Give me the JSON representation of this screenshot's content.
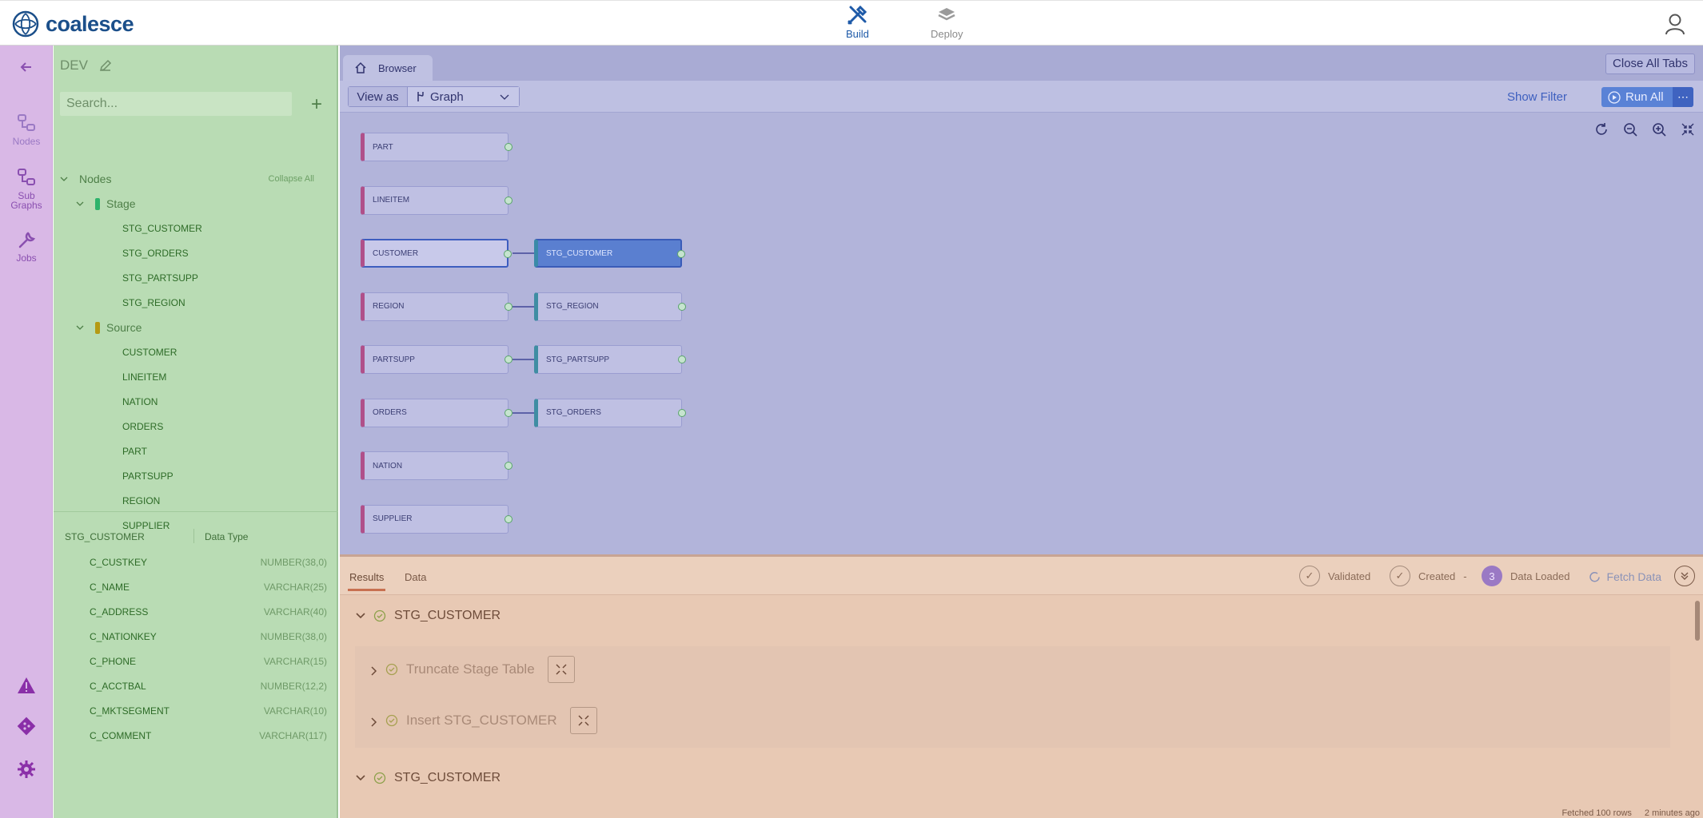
{
  "app": {
    "name": "coalesce"
  },
  "topnav": {
    "build": "Build",
    "deploy": "Deploy"
  },
  "rail": {
    "nodes": "Nodes",
    "subgraphs": "Sub Graphs",
    "jobs": "Jobs"
  },
  "sidebar": {
    "env": "DEV",
    "search_placeholder": "Search...",
    "collapse_all": "Collapse All",
    "root": "Nodes",
    "groups": [
      {
        "label": "Stage",
        "color": "#2db36b",
        "items": [
          "STG_CUSTOMER",
          "STG_ORDERS",
          "STG_PARTSUPP",
          "STG_REGION"
        ]
      },
      {
        "label": "Source",
        "color": "#b59a14",
        "items": [
          "CUSTOMER",
          "LINEITEM",
          "NATION",
          "ORDERS",
          "PART",
          "PARTSUPP",
          "REGION",
          "SUPPLIER"
        ]
      }
    ],
    "columns_header": {
      "name": "STG_CUSTOMER",
      "type": "Data Type"
    },
    "columns": [
      {
        "name": "C_CUSTKEY",
        "type": "NUMBER(38,0)"
      },
      {
        "name": "C_NAME",
        "type": "VARCHAR(25)"
      },
      {
        "name": "C_ADDRESS",
        "type": "VARCHAR(40)"
      },
      {
        "name": "C_NATIONKEY",
        "type": "NUMBER(38,0)"
      },
      {
        "name": "C_PHONE",
        "type": "VARCHAR(15)"
      },
      {
        "name": "C_ACCTBAL",
        "type": "NUMBER(12,2)"
      },
      {
        "name": "C_MKTSEGMENT",
        "type": "VARCHAR(10)"
      },
      {
        "name": "C_COMMENT",
        "type": "VARCHAR(117)"
      }
    ]
  },
  "browser": {
    "tab": "Browser",
    "close_all": "Close All Tabs",
    "view_as": "View as",
    "view_mode": "Graph",
    "show_filter": "Show Filter",
    "run_all": "Run All"
  },
  "graph": {
    "sources": [
      "PART",
      "LINEITEM",
      "CUSTOMER",
      "REGION",
      "PARTSUPP",
      "ORDERS",
      "NATION",
      "SUPPLIER"
    ],
    "stages": [
      "STG_CUSTOMER",
      "STG_REGION",
      "STG_PARTSUPP",
      "STG_ORDERS"
    ]
  },
  "results": {
    "tabs": [
      "Results",
      "Data"
    ],
    "status": {
      "validated": "Validated",
      "created": "Created",
      "dash": "-",
      "loaded_count": "3",
      "data_loaded": "Data Loaded"
    },
    "fetch": "Fetch Data",
    "header1": "STG_CUSTOMER",
    "steps": [
      "Truncate Stage Table",
      "Insert STG_CUSTOMER"
    ],
    "header2": "STG_CUSTOMER",
    "footer": {
      "fetched": "Fetched 100 rows",
      "time": "2 minutes ago"
    }
  }
}
